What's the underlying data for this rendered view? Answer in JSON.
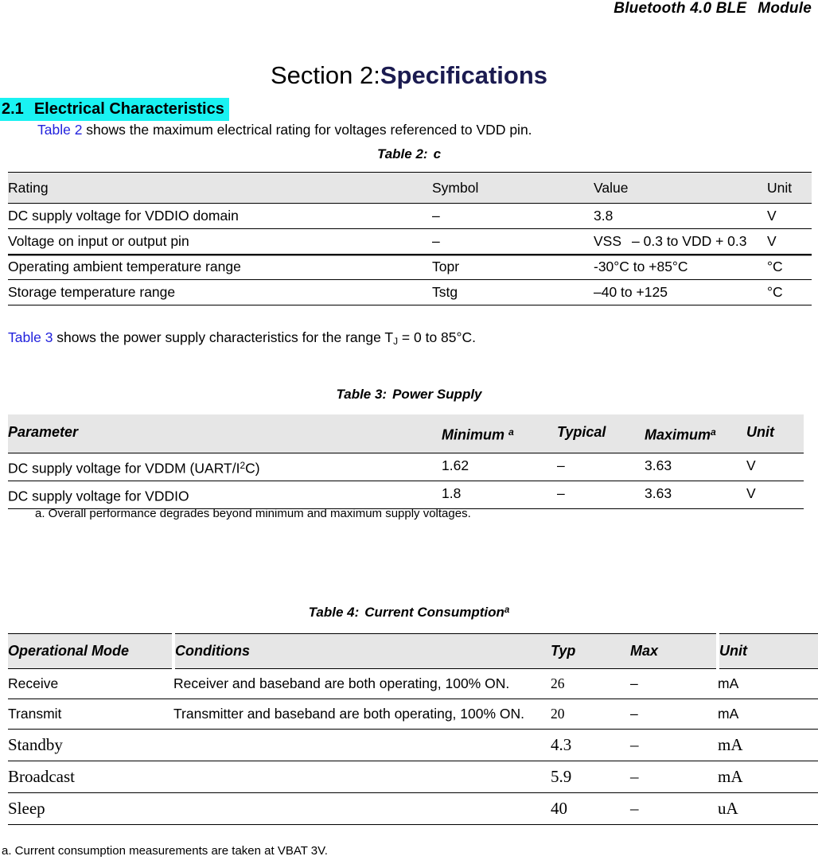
{
  "page_header": {
    "left_text": "Bluetooth 4.0 BLE",
    "right_text": "Module"
  },
  "section_title": {
    "number": "Section 2:",
    "name": "Specifications"
  },
  "sub_heading": {
    "number": "2.1",
    "text": "Electrical Characteristics",
    "highlight_color": "#19f2f2"
  },
  "intro_paragraph": {
    "link": "Table 2",
    "rest": " shows the maximum electrical rating for voltages referenced to VDD pin."
  },
  "table2": {
    "caption_label": "Table 2:",
    "caption_title": "c",
    "headers": [
      "Rating",
      "Symbol",
      "Value",
      "Unit"
    ],
    "rows": [
      {
        "rating": "DC supply voltage for VDDIO domain",
        "symbol": "–",
        "value": "3.8",
        "unit": "V"
      },
      {
        "rating": "Voltage on input or output pin",
        "symbol": "–",
        "value_a": "VSS",
        "value_b": "– 0.3 to VDD + 0.3",
        "unit": "V"
      },
      {
        "rating": "Operating ambient temperature range",
        "symbol": "Topr",
        "value": "-30°C to +85°C",
        "unit": "°C"
      },
      {
        "rating": "Storage temperature range",
        "symbol": "Tstg",
        "value": "–40 to +125",
        "unit": "°C"
      }
    ]
  },
  "table3_intro": {
    "link": "Table 3",
    "mid": " shows the power supply characteristics for the range T",
    "subscript": "J",
    "end": " = 0 to 85°C."
  },
  "table3": {
    "caption_label": "Table 3:",
    "caption_title": "Power Supply",
    "headers": {
      "parameter": "Parameter",
      "minimum": "Minimum",
      "minimum_note": "a",
      "typical": "Typical",
      "maximum": "Maximum",
      "maximum_note": "a",
      "unit": "Unit"
    },
    "rows": [
      {
        "parameter_a": "DC supply voltage for VDDM (UART/I",
        "parameter_sup": "2",
        "parameter_b": "C)",
        "minimum": "1.62",
        "typical": "–",
        "maximum": "3.63",
        "unit": "V"
      },
      {
        "parameter_a": "DC supply voltage for VDDIO",
        "parameter_sup": "",
        "parameter_b": "",
        "minimum": "1.8",
        "typical": "–",
        "maximum": "3.63",
        "unit": "V"
      }
    ],
    "footnote": "a. Overall performance degrades beyond minimum and maximum supply voltages."
  },
  "table4": {
    "caption_label": "Table 4:",
    "caption_title": "Current Consumption",
    "caption_note": "a",
    "headers": [
      "Operational Mode",
      "Conditions",
      "Typ",
      "Max",
      "Unit"
    ],
    "rows": [
      {
        "mode": "Receive",
        "conditions": "Receiver and baseband are both operating, 100% ON.",
        "typ": "26",
        "max": "–",
        "unit": "mA",
        "serif": false
      },
      {
        "mode": "Transmit",
        "conditions": "Transmitter and baseband are both operating, 100% ON.",
        "typ": "20",
        "max": "–",
        "unit": "mA",
        "serif": false
      },
      {
        "mode": "Standby",
        "conditions": "",
        "typ": "4.3",
        "max": "–",
        "unit": "mA",
        "serif": true
      },
      {
        "mode": "Broadcast",
        "conditions": "",
        "typ": "5.9",
        "max": "–",
        "unit": "mA",
        "serif": true
      },
      {
        "mode": "Sleep",
        "conditions": "",
        "typ": "40",
        "max": "–",
        "unit": "uA",
        "serif": true
      }
    ],
    "footnote": "a. Current consumption measurements are taken at VBAT 3V."
  }
}
